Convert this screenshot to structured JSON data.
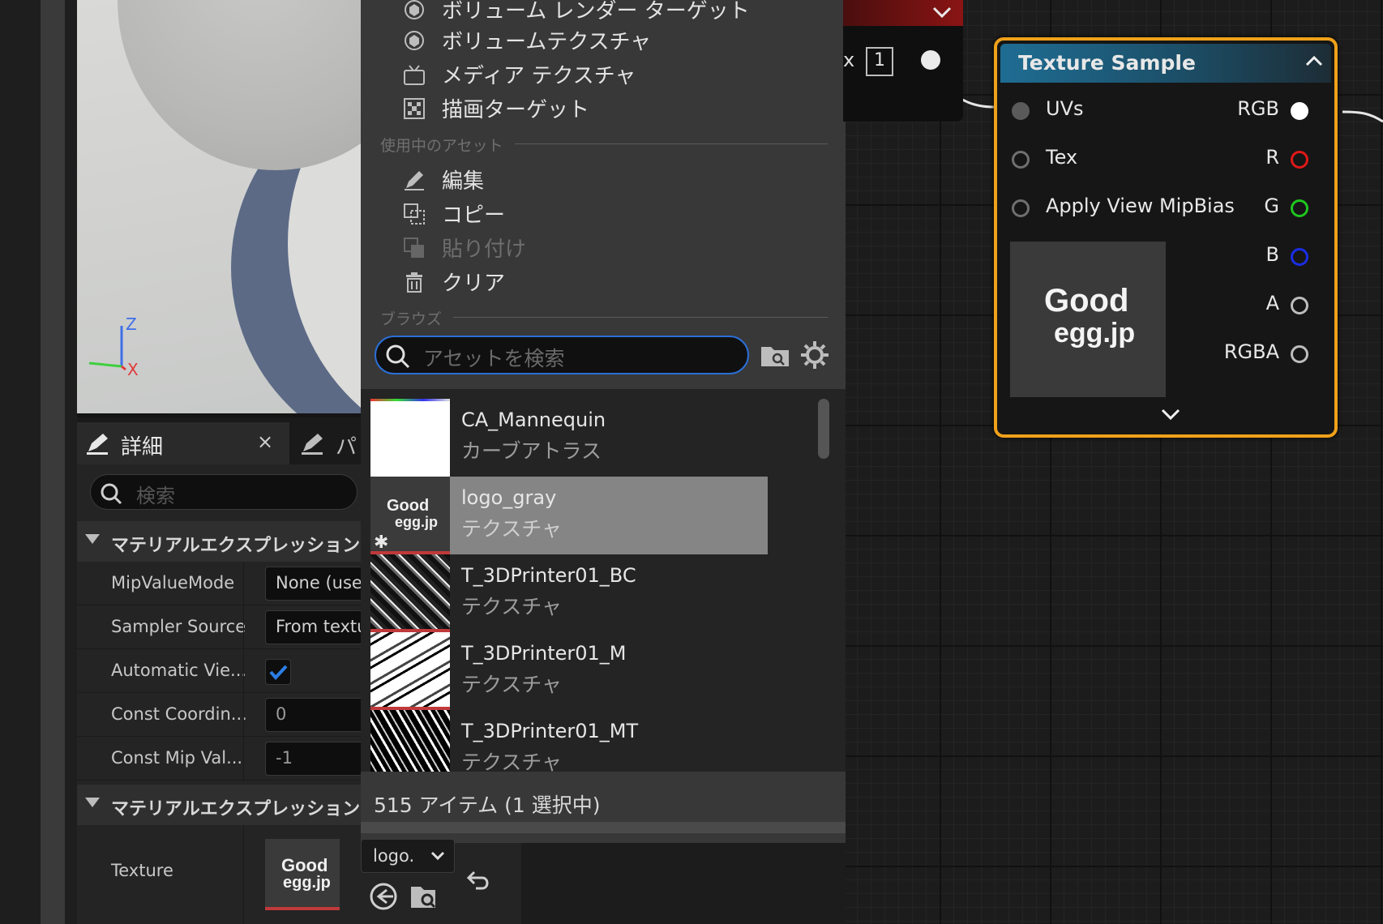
{
  "menu": {
    "items_top": [
      {
        "label": "ボリューム レンダー ターゲット",
        "icon": "volume-render-target-icon"
      },
      {
        "label": "ボリュームテクスチャ",
        "icon": "volume-texture-icon"
      },
      {
        "label": "メディア テクスチャ",
        "icon": "media-texture-icon"
      },
      {
        "label": "描画ターゲット",
        "icon": "render-target-icon"
      }
    ],
    "section_current_asset": "使用中のアセット",
    "items_asset": [
      {
        "label": "編集",
        "icon": "edit-icon"
      },
      {
        "label": "コピー",
        "icon": "copy-icon"
      },
      {
        "label": "貼り付け",
        "icon": "paste-icon",
        "disabled": true
      },
      {
        "label": "クリア",
        "icon": "trash-icon"
      }
    ],
    "section_browse": "ブラウズ",
    "search_placeholder": "アセットを検索",
    "assets": [
      {
        "name": "CA_Mannequin",
        "type": "カーブアトラス"
      },
      {
        "name": "logo_gray",
        "type": "テクスチャ",
        "selected": true
      },
      {
        "name": "T_3DPrinter01_BC",
        "type": "テクスチャ"
      },
      {
        "name": "T_3DPrinter01_M",
        "type": "テクスチャ"
      },
      {
        "name": "T_3DPrinter01_MT",
        "type": "テクスチャ"
      }
    ],
    "status": "515 アイテム (1 選択中)"
  },
  "details": {
    "tab_active": "詳細",
    "tab_other": "パ",
    "search_placeholder": "検索",
    "section1": "マテリアルエクスプレッションテクスチャ",
    "section2": "マテリアルエクスプレッションテクスチャ",
    "properties": [
      {
        "label": "MipValueMode",
        "value": "None (use"
      },
      {
        "label": "Sampler Source",
        "value": "From textu"
      },
      {
        "label": "Automatic Vie...",
        "checked": true
      },
      {
        "label": "Const Coordin...",
        "value": "0"
      },
      {
        "label": "Const Mip Val...",
        "value": "-1"
      }
    ],
    "texture_label": "Texture",
    "texture_combo": "logo."
  },
  "node": {
    "title": "Texture Sample",
    "inputs": [
      "UVs",
      "Tex",
      "Apply View MipBias"
    ],
    "outputs": [
      {
        "label": "RGB",
        "color": "#ffffff"
      },
      {
        "label": "R",
        "color": "#e01818"
      },
      {
        "label": "G",
        "color": "#1ec61e"
      },
      {
        "label": "B",
        "color": "#1a2ee6"
      },
      {
        "label": "A",
        "color": "#bdbdbd"
      },
      {
        "label": "RGBA",
        "color": "#bdbdbd"
      }
    ],
    "logo_line1": "Good",
    "logo_line2": "egg.jp"
  },
  "prev_node": {
    "x_label": "x",
    "index": "1"
  },
  "viewport": {
    "axis_z": "Z",
    "axis_x": "X"
  },
  "colors": {
    "accent_blue": "#2b6fd6",
    "node_border": "#f0a11a",
    "node_header": "#1f6d93",
    "selected_row": "#858585"
  }
}
